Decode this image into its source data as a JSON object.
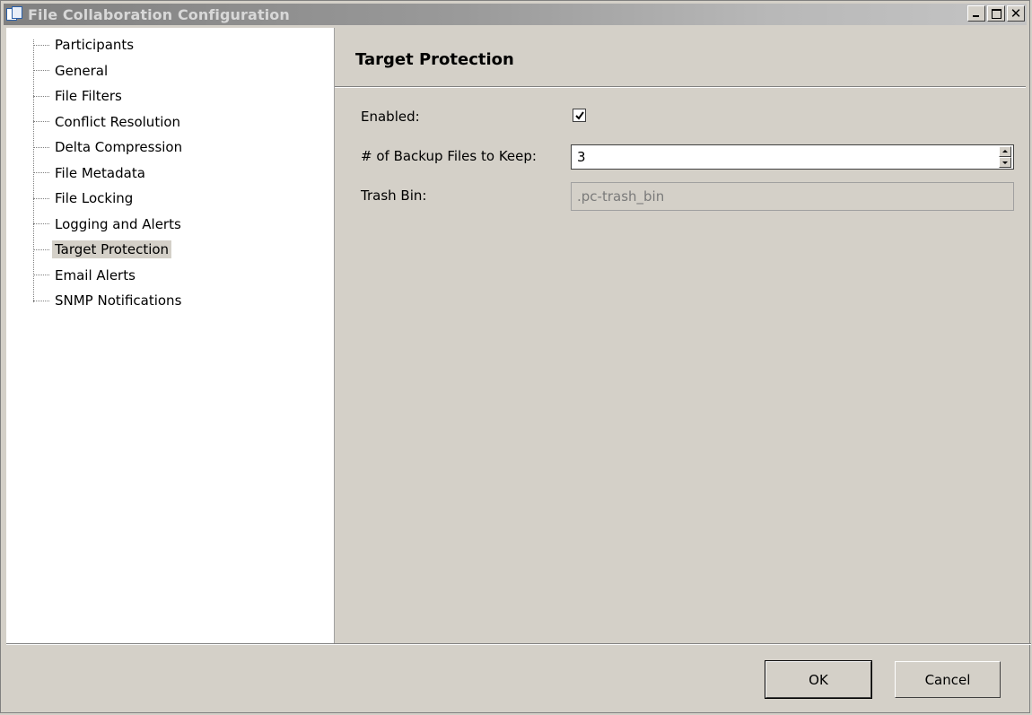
{
  "window": {
    "title": "File Collaboration Configuration",
    "controls": {
      "minimize": "_",
      "maximize": "□",
      "close": "✕"
    }
  },
  "tree": {
    "items": [
      {
        "label": "Participants",
        "selected": false
      },
      {
        "label": "General",
        "selected": false
      },
      {
        "label": "File Filters",
        "selected": false
      },
      {
        "label": "Conflict Resolution",
        "selected": false
      },
      {
        "label": "Delta Compression",
        "selected": false
      },
      {
        "label": "File Metadata",
        "selected": false
      },
      {
        "label": "File Locking",
        "selected": false
      },
      {
        "label": "Logging and Alerts",
        "selected": false
      },
      {
        "label": "Target Protection",
        "selected": true
      },
      {
        "label": "Email Alerts",
        "selected": false
      },
      {
        "label": "SNMP Notifications",
        "selected": false
      }
    ]
  },
  "content": {
    "title": "Target Protection",
    "enabled_label": "Enabled:",
    "enabled_checked": true,
    "backup_label": "# of Backup Files to Keep:",
    "backup_value": "3",
    "trash_label": "Trash Bin:",
    "trash_value": ".pc-trash_bin"
  },
  "footer": {
    "ok_label": "OK",
    "cancel_label": "Cancel"
  }
}
